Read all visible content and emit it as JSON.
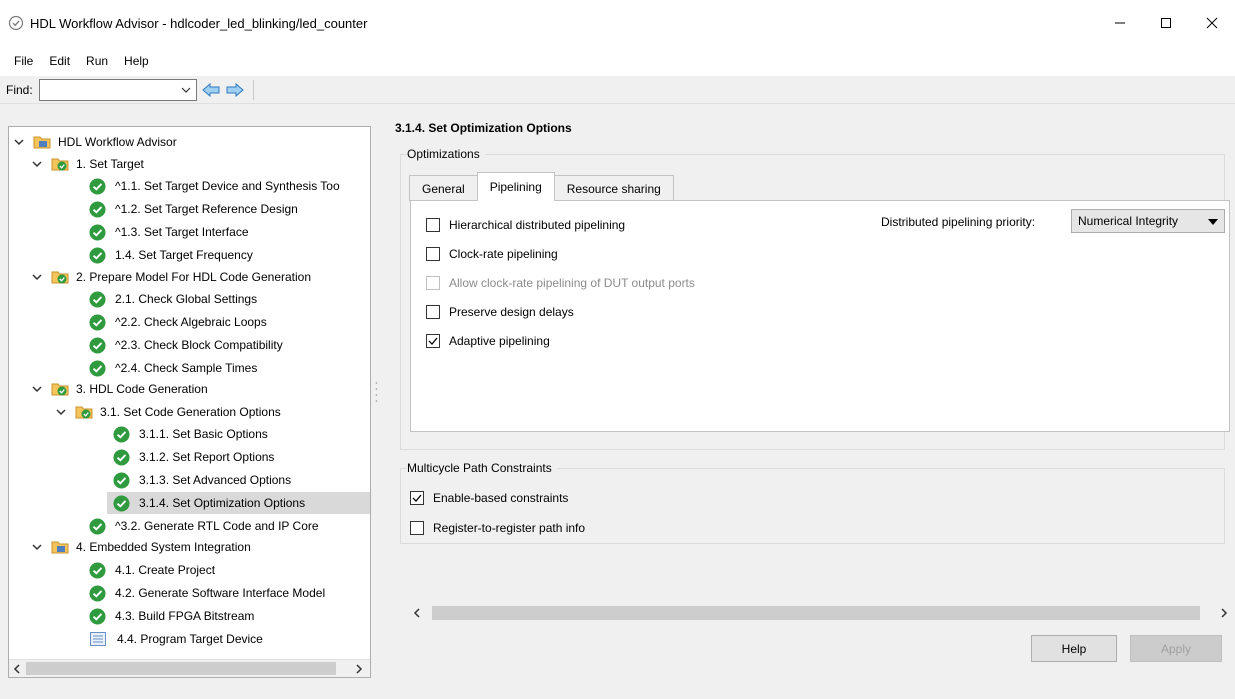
{
  "window": {
    "title": "HDL Workflow Advisor - hdlcoder_led_blinking/led_counter",
    "app_icon": "matlab-check-icon",
    "controls": [
      "minimize",
      "maximize",
      "close"
    ]
  },
  "menu": [
    "File",
    "Edit",
    "Run",
    "Help"
  ],
  "toolbar": {
    "find_label": "Find:",
    "find_value": "",
    "back_icon": "arrow-left-icon",
    "forward_icon": "arrow-right-icon"
  },
  "tree": {
    "items": [
      {
        "label": "HDL Workflow Advisor",
        "icon": "folder-icon",
        "expanded": true
      },
      {
        "label": "1. Set Target",
        "icon": "folder-check-icon",
        "expanded": true
      },
      {
        "label": "^1.1. Set Target Device and Synthesis Too",
        "icon": "check-icon"
      },
      {
        "label": "^1.2. Set Target Reference Design",
        "icon": "check-icon"
      },
      {
        "label": "^1.3. Set Target Interface",
        "icon": "check-icon"
      },
      {
        "label": "1.4. Set Target Frequency",
        "icon": "check-icon"
      },
      {
        "label": "2. Prepare Model For HDL Code Generation",
        "icon": "folder-check-icon",
        "expanded": true
      },
      {
        "label": "2.1. Check Global Settings",
        "icon": "check-icon"
      },
      {
        "label": "^2.2. Check Algebraic Loops",
        "icon": "check-icon"
      },
      {
        "label": "^2.3. Check Block Compatibility",
        "icon": "check-icon"
      },
      {
        "label": "^2.4. Check Sample Times",
        "icon": "check-icon"
      },
      {
        "label": "3. HDL Code Generation",
        "icon": "folder-check-icon",
        "expanded": true
      },
      {
        "label": "3.1. Set Code Generation Options",
        "icon": "folder-check-icon",
        "expanded": true
      },
      {
        "label": "3.1.1. Set Basic Options",
        "icon": "check-icon"
      },
      {
        "label": "3.1.2. Set Report Options",
        "icon": "check-icon"
      },
      {
        "label": "3.1.3. Set Advanced Options",
        "icon": "check-icon"
      },
      {
        "label": "3.1.4. Set Optimization Options",
        "icon": "check-icon",
        "selected": true
      },
      {
        "label": "^3.2. Generate RTL Code and IP Core",
        "icon": "check-icon"
      },
      {
        "label": "4. Embedded System Integration",
        "icon": "folder-icon",
        "expanded": true
      },
      {
        "label": "4.1. Create Project",
        "icon": "check-icon"
      },
      {
        "label": "4.2. Generate Software Interface Model",
        "icon": "check-icon"
      },
      {
        "label": "4.3. Build FPGA Bitstream",
        "icon": "check-icon"
      },
      {
        "label": "4.4. Program Target Device",
        "icon": "document-icon"
      }
    ]
  },
  "panel": {
    "heading": "3.1.4. Set Optimization Options",
    "optimizations_group": "Optimizations",
    "tabs": [
      {
        "label": "General",
        "active": false
      },
      {
        "label": "Pipelining",
        "active": true
      },
      {
        "label": "Resource sharing",
        "active": false
      }
    ],
    "pipelining": {
      "hierarchical": {
        "label": "Hierarchical distributed pipelining",
        "checked": false
      },
      "clock_rate": {
        "label": "Clock-rate pipelining",
        "checked": false
      },
      "allow_output": {
        "label": "Allow clock-rate pipelining of DUT output ports",
        "checked": false,
        "disabled": true
      },
      "preserve": {
        "label": "Preserve design delays",
        "checked": false
      },
      "adaptive": {
        "label": "Adaptive pipelining",
        "checked": true
      },
      "priority_label": "Distributed pipelining priority:",
      "priority_value": "Numerical Integrity"
    },
    "multicycle_group": "Multicycle Path Constraints",
    "multicycle": {
      "enable_based": {
        "label": "Enable-based constraints",
        "checked": true
      },
      "register_path": {
        "label": "Register-to-register path info",
        "checked": false
      }
    },
    "buttons": {
      "help": "Help",
      "apply": "Apply"
    }
  }
}
